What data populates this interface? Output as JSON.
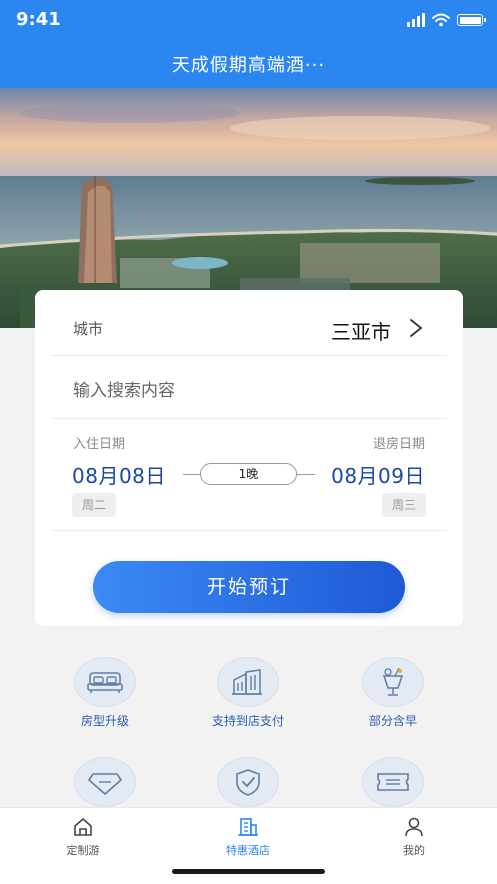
{
  "status_bar": {
    "time": "9:41"
  },
  "header": {
    "title": "天成假期高端酒···"
  },
  "booking": {
    "city_label": "城市",
    "city_value": "三亚市",
    "search_placeholder": "输入搜索内容",
    "checkin_label": "入住日期",
    "checkout_label": "退房日期",
    "checkin_date": "08月08日",
    "checkout_date": "08月09日",
    "nights": "1晚",
    "checkin_weekday": "周二",
    "checkout_weekday": "周三",
    "book_button": "开始预订"
  },
  "features": [
    {
      "label": "房型升级",
      "icon": "bed-icon"
    },
    {
      "label": "支持到店支付",
      "icon": "building-icon"
    },
    {
      "label": "部分含早",
      "icon": "drink-icon"
    },
    {
      "label": "",
      "icon": "diamond-icon"
    },
    {
      "label": "",
      "icon": "shield-check-icon"
    },
    {
      "label": "",
      "icon": "ticket-icon"
    }
  ],
  "tabs": [
    {
      "label": "定制游",
      "icon": "home-icon",
      "active": false
    },
    {
      "label": "特惠酒店",
      "icon": "hotel-icon",
      "active": true
    },
    {
      "label": "我的",
      "icon": "user-icon",
      "active": false
    }
  ],
  "colors": {
    "primary": "#2b86f0",
    "date_text": "#1a47a8",
    "button_start": "#3b8af4",
    "button_end": "#1e59d6"
  }
}
